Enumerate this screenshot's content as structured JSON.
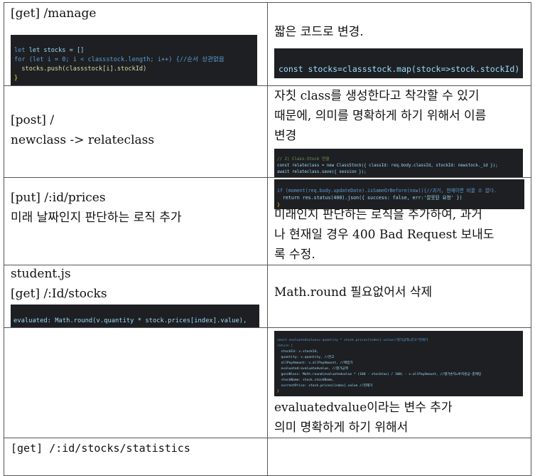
{
  "rows": [
    {
      "left": {
        "title": "[get] /manage",
        "code": [
          "let stocks = []",
          "for (let i = 0; i < classstock.length; i++) {//순서 상관없음",
          "  stocks.push(classstock[i].stockId)",
          "}"
        ]
      },
      "right": {
        "text": "짧은 코드로 변경.",
        "code": "const stocks=classstock.map(stock=>stock.stockId)"
      }
    },
    {
      "left": {
        "line1": "[post] /",
        "line2": "newclass -> relateclass"
      },
      "right": {
        "text_lines": [
          "자칫 class를 생성한다고 착각할 수 있기",
          "때문에, 의미를 명확하게 하기 위해서 이름",
          "변경"
        ],
        "code": [
          "// 2) Class-Stock 연결",
          "const relateclass = new ClassStock({ classId: req.body.classId, stockId: newstock._id });",
          "await relateclass.save({ session });"
        ]
      }
    },
    {
      "left": {
        "line1": "[put] /:id/prices",
        "line2": "미래 날짜인지 판단하는 로직 추가"
      },
      "right": {
        "code": [
          "if (moment(req.body.updateDate).isSameOrBefore(now)){//과거, 현재이면 바꿀 수 없다.",
          "  return res.status(400).json({ success: false, err:'잘못된 요청' })",
          "}"
        ],
        "text_lines": [
          "미래인지 판단하는 로직을 추가하여, 과거",
          "나 현재일 경우 400 Bad Request 보내도",
          "록 수정."
        ]
      }
    },
    {
      "left": {
        "line1": "student.js",
        "line2": "[get] /:Id/stocks",
        "code": "evaluated: Math.round(v.quantity * stock.prices[index].value),"
      },
      "right": {
        "text": "Math.round 필요없어서 삭제"
      }
    },
    {
      "left": {},
      "right": {
        "code": [
          "const evaluatedvalue=v.quantity * stock.prices[index].value//평가금액=잔고*현재가",
          "return {",
          "  stockId: v.stockId,",
          "  quantity: v.quantity, //잔고",
          "  allPayAmount: v.allPayAmount, //매입가",
          "  evaluated:evaluatedvalue, //평가금액",
          "  gainNloss: Math.round(evaluatedvalue * (100 - stocktax) / 100) - v.allPayAmount, //평가손익=투자원금-총매입",
          "  stockName: stock.stockName,",
          "  currentPrice: stock.prices[index].value //현재가",
          "}"
        ],
        "text_lines": [
          "evaluatedvalue이라는 변수 추가",
          "의미 명확하게 하기 위해서"
        ]
      }
    },
    {
      "left": {
        "title": "[get] /:id/stocks/statistics"
      },
      "right": {}
    }
  ]
}
